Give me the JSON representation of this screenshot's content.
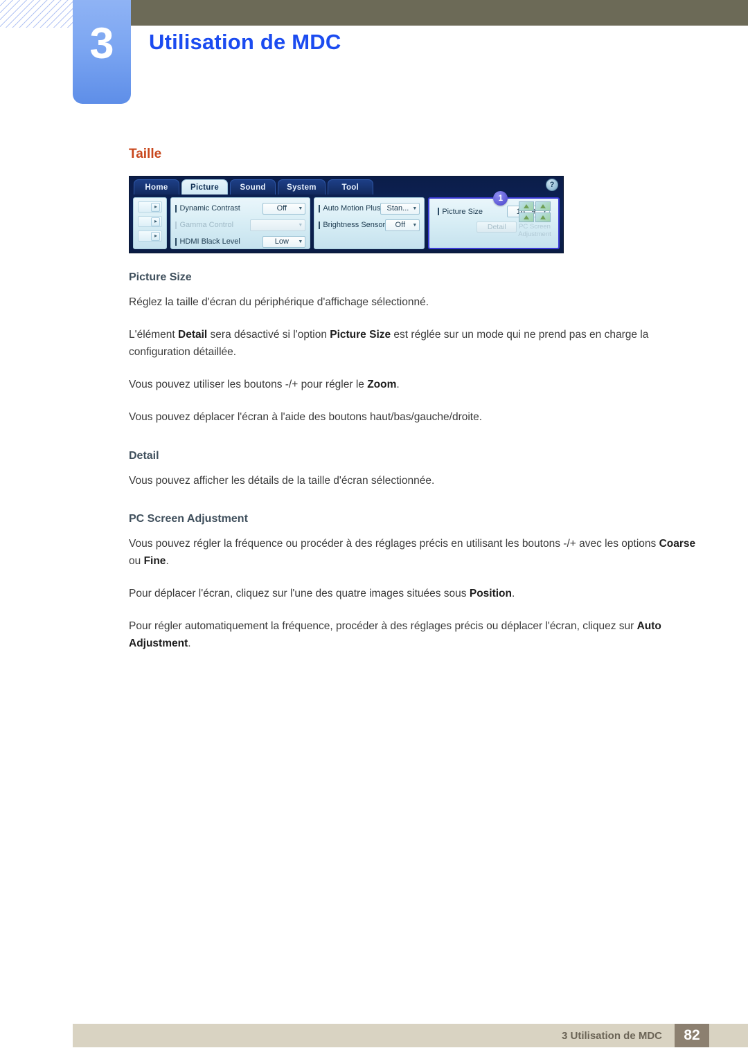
{
  "header": {
    "chapter_number": "3",
    "title": "Utilisation de MDC",
    "title_color": "#1b4bf0",
    "bar_color": "#6c6a57"
  },
  "content": {
    "section_heading": "Taille",
    "section_heading_color": "#c8461b",
    "blocks": [
      {
        "type": "subheading",
        "text": "Picture Size"
      },
      {
        "type": "paragraph",
        "text": "Réglez la taille d'écran du périphérique d'affichage sélectionné."
      },
      {
        "type": "paragraph",
        "text": "L'élément Detail sera désactivé si l'option Picture Size est réglée sur un mode qui ne prend pas en charge la configuration détaillée."
      },
      {
        "type": "paragraph",
        "text": "Vous pouvez utiliser les boutons -/+ pour régler le Zoom."
      },
      {
        "type": "paragraph",
        "text": "Vous pouvez déplacer l'écran à l'aide des boutons haut/bas/gauche/droite."
      },
      {
        "type": "subheading",
        "text": "Detail"
      },
      {
        "type": "paragraph",
        "text": "Vous pouvez afficher les détails de la taille d'écran sélectionnée."
      },
      {
        "type": "subheading",
        "text": "PC Screen Adjustment"
      },
      {
        "type": "paragraph",
        "text": "Vous pouvez régler la fréquence ou procéder à des réglages précis en utilisant les boutons -/+ avec les options Coarse ou Fine."
      },
      {
        "type": "paragraph",
        "text": "Pour déplacer l'écran, cliquez sur l'une des quatre images situées sous Position."
      },
      {
        "type": "paragraph",
        "text": "Pour régler automatiquement la fréquence, procéder à des réglages précis ou déplacer l'écran, cliquez sur Auto Adjustment."
      }
    ],
    "paragraphs": {
      "p1": "Réglez la taille d'écran du périphérique d'affichage sélectionné.",
      "p2_a": "L'élément ",
      "p2_b1": "Detail",
      "p2_b": " sera désactivé si l'option ",
      "p2_b2": "Picture Size",
      "p2_c": " est réglée sur un mode qui ne prend pas en charge la configuration détaillée.",
      "p3_a": "Vous pouvez utiliser les boutons -/+ pour régler le ",
      "p3_b": "Zoom",
      "p3_c": ".",
      "p4": "Vous pouvez déplacer l'écran à l'aide des boutons haut/bas/gauche/droite.",
      "p5": "Vous pouvez afficher les détails de la taille d'écran sélectionnée.",
      "p6_a": "Vous pouvez régler la fréquence ou procéder à des réglages précis en utilisant les boutons -/+ avec les options ",
      "p6_b": "Coarse",
      "p6_c": " ou ",
      "p6_d": "Fine",
      "p6_e": ".",
      "p7_a": "Pour déplacer l'écran, cliquez sur l'une des quatre images situées sous ",
      "p7_b": "Position",
      "p7_c": ".",
      "p8_a": "Pour régler automatiquement la fréquence, procéder à des réglages précis ou déplacer l'écran, cliquez sur ",
      "p8_b": "Auto Adjustment",
      "p8_c": "."
    },
    "headings": {
      "h1": "Picture Size",
      "h2": "Detail",
      "h3": "PC Screen Adjustment"
    }
  },
  "mdc_screenshot": {
    "tabs": [
      {
        "label": "Home",
        "active": false
      },
      {
        "label": "Picture",
        "active": true
      },
      {
        "label": "Sound",
        "active": false
      },
      {
        "label": "System",
        "active": false
      },
      {
        "label": "Tool",
        "active": false
      }
    ],
    "help_icon": "?",
    "left_group": {
      "arrow_glyph": "▸",
      "rows": 3
    },
    "picture_group": [
      {
        "label": "Dynamic Contrast",
        "value": "Off",
        "disabled": false
      },
      {
        "label": "Gamma Control",
        "value": "",
        "disabled": true
      },
      {
        "label": "HDMI Black Level",
        "value": "Low",
        "disabled": false
      }
    ],
    "motion_group": [
      {
        "label": "Auto Motion Plus",
        "value": "Stan...",
        "disabled": false
      },
      {
        "label": "Brightness Sensor",
        "value": "Off",
        "disabled": false
      }
    ],
    "size_group": {
      "label": "Picture Size",
      "value": "16 : 9",
      "detail_button": "Detail",
      "detail_disabled": true,
      "pc_screen_adjustment_label_line1": "PC Screen",
      "pc_screen_adjustment_label_line2": "Adjustment",
      "callout_badge": "1",
      "highlight_color": "#3b3bd6"
    }
  },
  "footer": {
    "text": "3 Utilisation de MDC",
    "page_number": "82",
    "bar_color": "#d9d3c2",
    "page_box_color": "#8c8070"
  }
}
